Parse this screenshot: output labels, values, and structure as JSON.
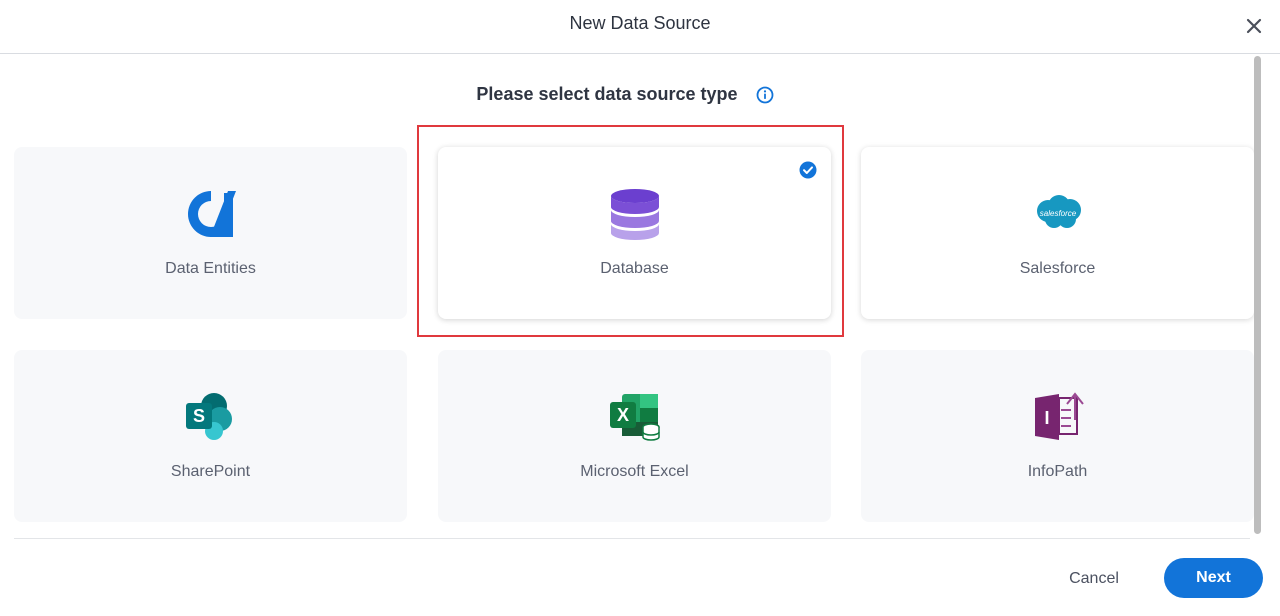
{
  "dialog": {
    "title": "New Data Source",
    "subtitle": "Please select data source type"
  },
  "cards": [
    {
      "label": "Data Entities",
      "icon": "data-entities-icon"
    },
    {
      "label": "Database",
      "icon": "database-icon",
      "selected": true
    },
    {
      "label": "Salesforce",
      "icon": "salesforce-icon",
      "logo_text": "salesforce"
    },
    {
      "label": "SharePoint",
      "icon": "sharepoint-icon",
      "logo_text": "S"
    },
    {
      "label": "Microsoft Excel",
      "icon": "excel-icon",
      "logo_text": "X"
    },
    {
      "label": "InfoPath",
      "icon": "infopath-icon",
      "logo_text": "I"
    }
  ],
  "footer": {
    "cancel_label": "Cancel",
    "next_label": "Next"
  },
  "colors": {
    "accent": "#1274d9",
    "highlight": "#e0393e",
    "database": "#7b4fd6",
    "salesforce": "#1798c1",
    "sharepoint": "#036c70",
    "excel": "#107c41",
    "infopath": "#77256f"
  }
}
